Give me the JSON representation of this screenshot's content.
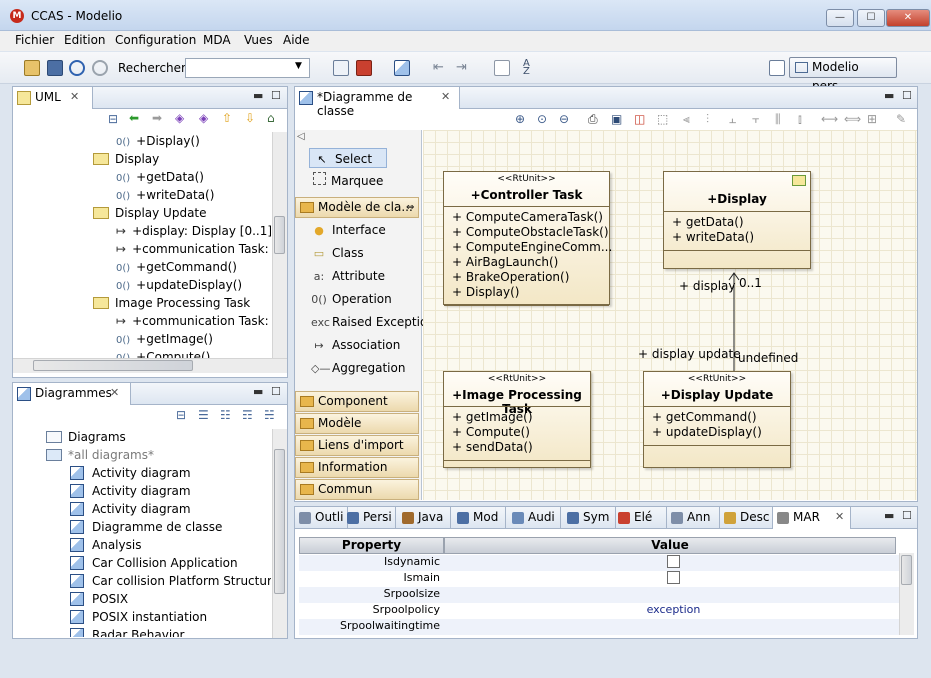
{
  "window": {
    "title": "CCAS - Modelio",
    "icon_text": "M",
    "minimize": "—",
    "maximize": "☐",
    "close": "✕"
  },
  "menubar": [
    "Fichier",
    "Edition",
    "Configuration",
    "MDA",
    "Vues",
    "Aide"
  ],
  "toolbar": {
    "search_label": "Rechercher :",
    "search_value": "",
    "perspective_label": "Modelio pers..."
  },
  "uml_panel": {
    "tab": "UML",
    "tree": [
      {
        "kind": "op",
        "indent": 2,
        "text": "+Display()"
      },
      {
        "kind": "class",
        "indent": 1,
        "text": "Display"
      },
      {
        "kind": "op",
        "indent": 2,
        "text": "+getData()"
      },
      {
        "kind": "op",
        "indent": 2,
        "text": "+writeData()"
      },
      {
        "kind": "class",
        "indent": 1,
        "text": "Display Update"
      },
      {
        "kind": "assoc",
        "indent": 2,
        "text": "+display: Display [0..1]"
      },
      {
        "kind": "assoc",
        "indent": 2,
        "text": "+communication Task: C"
      },
      {
        "kind": "op",
        "indent": 2,
        "text": "+getCommand()"
      },
      {
        "kind": "op",
        "indent": 2,
        "text": "+updateDisplay()"
      },
      {
        "kind": "class",
        "indent": 1,
        "text": "Image Processing Task"
      },
      {
        "kind": "assoc",
        "indent": 2,
        "text": "+communication Task: C"
      },
      {
        "kind": "op",
        "indent": 2,
        "text": "+getImage()"
      },
      {
        "kind": "op",
        "indent": 2,
        "text": "+Compute()"
      }
    ]
  },
  "diagrams_panel": {
    "tab": "Diagrammes",
    "tree": [
      {
        "kind": "folder",
        "indent": 0,
        "text": "Diagrams"
      },
      {
        "kind": "folder-open",
        "indent": 0,
        "text": "*all diagrams*",
        "muted": true
      },
      {
        "kind": "diag",
        "indent": 1,
        "text": "Activity diagram"
      },
      {
        "kind": "diag",
        "indent": 1,
        "text": "Activity diagram"
      },
      {
        "kind": "diag",
        "indent": 1,
        "text": "Activity diagram"
      },
      {
        "kind": "diag",
        "indent": 1,
        "text": "Diagramme de classe"
      },
      {
        "kind": "diag",
        "indent": 1,
        "text": "Analysis"
      },
      {
        "kind": "diag",
        "indent": 1,
        "text": "Car Collision Application"
      },
      {
        "kind": "diag",
        "indent": 1,
        "text": "Car collision Platform Structure"
      },
      {
        "kind": "diag",
        "indent": 1,
        "text": "POSIX"
      },
      {
        "kind": "diag",
        "indent": 1,
        "text": "POSIX instantiation"
      },
      {
        "kind": "diag",
        "indent": 1,
        "text": "Radar Behavior"
      }
    ]
  },
  "editor": {
    "tab": "*Diagramme de classe",
    "palette": {
      "tools": [
        "Select",
        "Marquee"
      ],
      "active_drawer": "Modèle de cla...",
      "items": [
        {
          "icon": "●",
          "label": "Interface"
        },
        {
          "icon": "▭",
          "label": "Class"
        },
        {
          "icon": "a:",
          "label": "Attribute"
        },
        {
          "icon": "0()",
          "label": "Operation"
        },
        {
          "icon": "exc",
          "label": "Raised Exception"
        },
        {
          "icon": "↦",
          "label": "Association"
        },
        {
          "icon": "◇—",
          "label": "Aggregation"
        }
      ],
      "drawers": [
        "Component model",
        "Modèle d'instances",
        "Liens d'import",
        "Information Flows",
        "Commun"
      ]
    },
    "classes": [
      {
        "stereotype": "<<RtUnit>>",
        "name": "+Controller Task",
        "ops": [
          "+ ComputeCameraTask()",
          "+ ComputeObstacleTask()",
          "+ ComputeEngineComm...",
          "+ AirBagLaunch()",
          "+ BrakeOperation()",
          "+ Display()"
        ]
      },
      {
        "stereotype": "",
        "name": "+Display",
        "ops": [
          "+ getData()",
          "+ writeData()"
        ]
      },
      {
        "stereotype": "<<RtUnit>>",
        "name": "+Image Processing Task",
        "ops": [
          "+ getImage()",
          "+ Compute()",
          "+ sendData()"
        ]
      },
      {
        "stereotype": "<<RtUnit>>",
        "name": "+Display Update",
        "ops": [
          "+ getCommand()",
          "+ updateDisplay()"
        ]
      }
    ],
    "connector": {
      "role_top": "+ display",
      "mult_top": "0..1",
      "role_bottom": "+ display update",
      "mult_bottom": "undefined"
    }
  },
  "bottom_panel": {
    "tabs": [
      "Outli",
      "Persi",
      "Java",
      "Mod",
      "Audi",
      "Sym",
      "Elé",
      "Ann",
      "Desc",
      "MAR"
    ],
    "active_tab": "MAR",
    "headers": {
      "property": "Property",
      "value": "Value"
    },
    "rows": [
      {
        "name": "Isdynamic",
        "value": "",
        "checkbox": true
      },
      {
        "name": "Ismain",
        "value": "",
        "checkbox": true
      },
      {
        "name": "Srpoolsize",
        "value": "",
        "checkbox": false
      },
      {
        "name": "Srpoolpolicy",
        "value": "exception",
        "checkbox": false
      },
      {
        "name": "Srpoolwaitingtime",
        "value": "",
        "checkbox": false
      }
    ]
  }
}
